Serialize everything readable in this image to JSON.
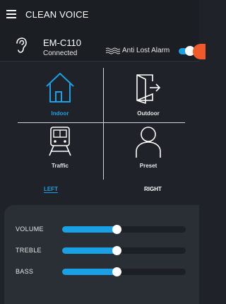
{
  "header": {
    "title": "CLEAN VOICE",
    "menu_icon": "hamburger-menu-icon"
  },
  "device": {
    "name": "EM-C110",
    "status": "Connected",
    "anti_lost_label": "Anti Lost Alarm",
    "anti_lost_enabled": true
  },
  "modes": [
    {
      "label": "Indoor",
      "icon": "house-icon",
      "active": true
    },
    {
      "label": "Outdoor",
      "icon": "door-exit-icon",
      "active": false
    },
    {
      "label": "Traffic",
      "icon": "train-icon",
      "active": false
    },
    {
      "label": "Preset",
      "icon": "person-icon",
      "active": false
    }
  ],
  "sides": {
    "left": "LEFT",
    "right": "RIGHT",
    "selected": "LEFT"
  },
  "sliders": [
    {
      "label": "VOLUME",
      "value": 0.44
    },
    {
      "label": "TREBLE",
      "value": 0.44
    },
    {
      "label": "BASS",
      "value": 0.44
    }
  ],
  "colors": {
    "accent": "#1aa0e4",
    "background": "#1f2228",
    "panel": "#2a2e35",
    "alert": "#f05a2b"
  }
}
